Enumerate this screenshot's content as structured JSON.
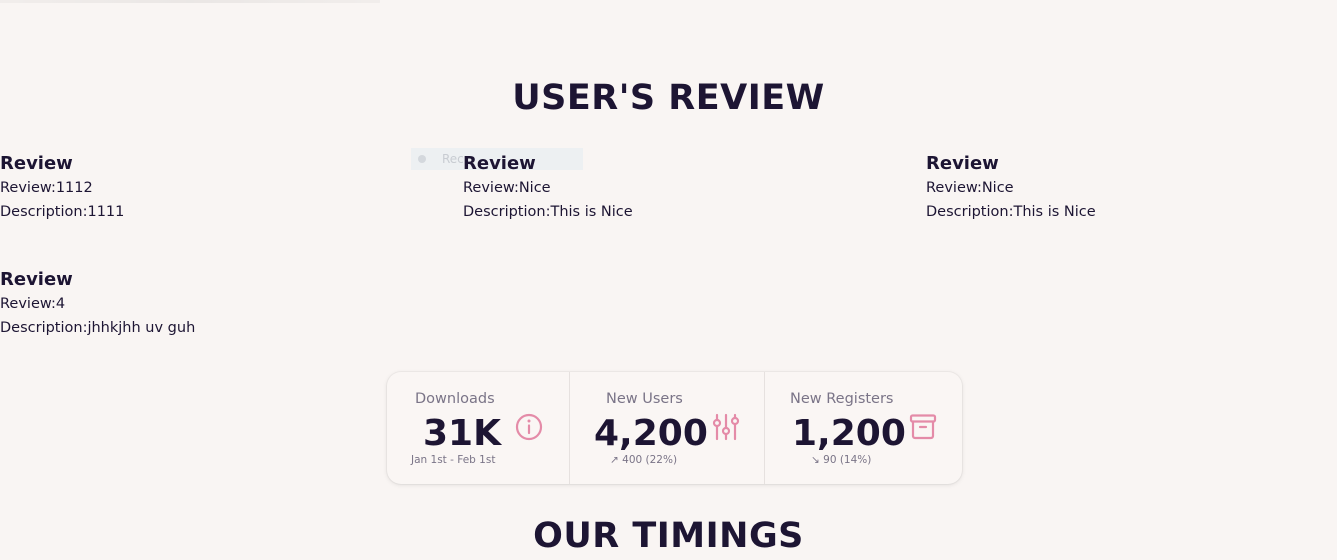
{
  "reviews_section": {
    "title": "USER'S REVIEW",
    "reviews": [
      {
        "heading": "Review",
        "review_line": "Review:1112",
        "description_line": "Description:1111"
      },
      {
        "heading": "Review",
        "review_line": "Review:Nice",
        "description_line": "Description:This is Nice"
      },
      {
        "heading": "Review",
        "review_line": "Review:Nice",
        "description_line": "Description:This is Nice"
      },
      {
        "heading": "Review",
        "review_line": "Review:4",
        "description_line": "Description:jhhkjhh uv guh"
      }
    ],
    "ghost_tooltip_text": "Rec"
  },
  "stats": [
    {
      "label": "Downloads",
      "value": "31K",
      "desc": "Jan 1st - Feb 1st",
      "icon": "info-circle-icon"
    },
    {
      "label": "New Users",
      "value": "4,200",
      "desc": "↗︎ 400 (22%)",
      "icon": "sliders-icon"
    },
    {
      "label": "New Registers",
      "value": "1,200",
      "desc": "↘︎ 90 (14%)",
      "icon": "archive-icon"
    }
  ],
  "timings_section": {
    "title": "OUR TIMINGS"
  },
  "colors": {
    "background": "#f9f5f3",
    "text": "#1d1533",
    "muted": "#7a7487",
    "accent_pink": "#e48ba8"
  }
}
